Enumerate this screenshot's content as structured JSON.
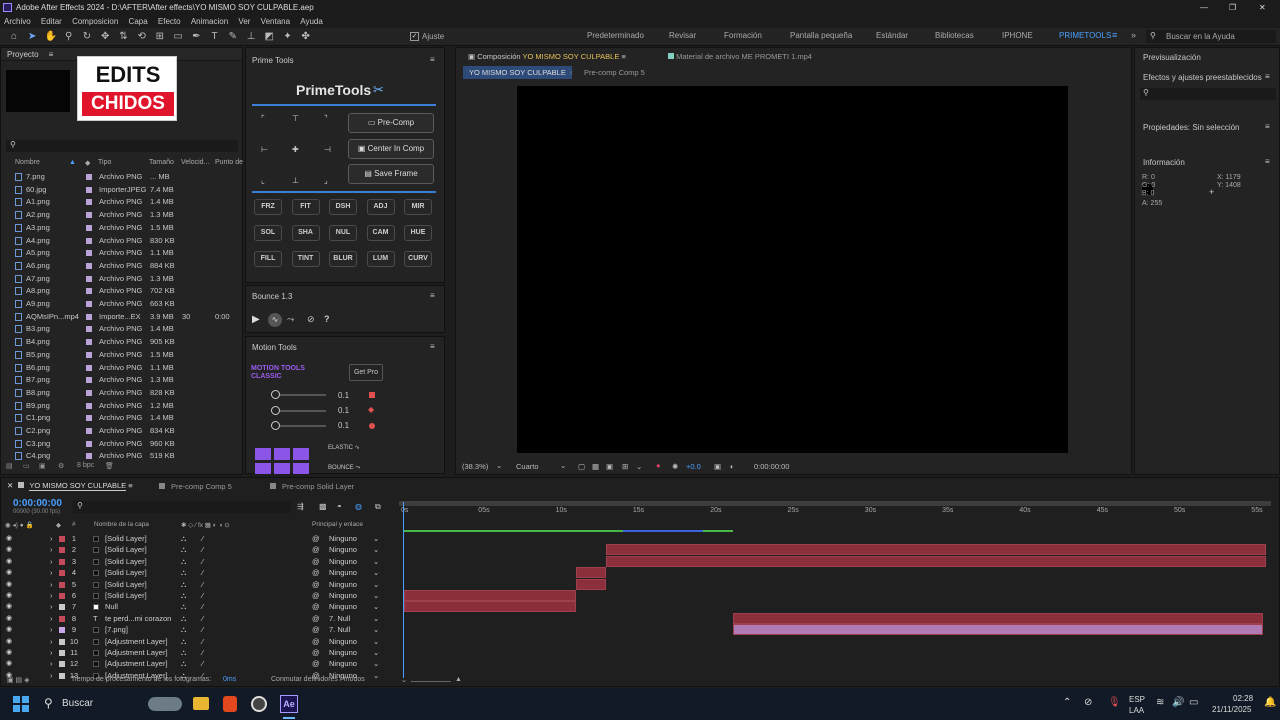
{
  "app": {
    "title": "Adobe After Effects 2024 - D:\\AFTER\\After effects\\YO MISMO SOY CULPABLE.aep"
  },
  "menu": [
    "Archivo",
    "Editar",
    "Composicion",
    "Capa",
    "Efecto",
    "Animacion",
    "Ver",
    "Ventana",
    "Ayuda"
  ],
  "toolbar": {
    "ajuste": "Ajuste"
  },
  "workspaces": [
    "Predeterminado",
    "Revisar",
    "Formación",
    "Pantalla pequeña",
    "Estándar",
    "Bibliotecas",
    "IPHONE",
    "PRIMETOOLS"
  ],
  "search_help": "Buscar en la Ayuda",
  "project": {
    "tab": "Proyecto",
    "thumb_line1": "EDITS",
    "thumb_line2": "CHIDOS",
    "columns": {
      "name": "Nombre",
      "type": "Tipo",
      "size": "Tamaño",
      "speed": "Velocid...",
      "point": "Punto de"
    },
    "bpc": "8 bpc",
    "files": [
      {
        "name": "7.png",
        "type": "Archivo PNG",
        "size": "... MB"
      },
      {
        "name": "60.jpg",
        "type": "ImporterJPEG",
        "size": "7.4 MB"
      },
      {
        "name": "A1.png",
        "type": "Archivo PNG",
        "size": "1.4 MB"
      },
      {
        "name": "A2.png",
        "type": "Archivo PNG",
        "size": "1.3 MB"
      },
      {
        "name": "A3.png",
        "type": "Archivo PNG",
        "size": "1.5 MB"
      },
      {
        "name": "A4.png",
        "type": "Archivo PNG",
        "size": "830 KB"
      },
      {
        "name": "A5.png",
        "type": "Archivo PNG",
        "size": "1.1 MB"
      },
      {
        "name": "A6.png",
        "type": "Archivo PNG",
        "size": "884 KB"
      },
      {
        "name": "A7.png",
        "type": "Archivo PNG",
        "size": "1.3 MB"
      },
      {
        "name": "A8.png",
        "type": "Archivo PNG",
        "size": "702 KB"
      },
      {
        "name": "A9.png",
        "type": "Archivo PNG",
        "size": "663 KB"
      },
      {
        "name": "AQMsIPn...mp4",
        "type": "Importe...EX",
        "size": "3.9 MB",
        "speed": "30",
        "point": "0:00"
      },
      {
        "name": "B3.png",
        "type": "Archivo PNG",
        "size": "1.4 MB"
      },
      {
        "name": "B4.png",
        "type": "Archivo PNG",
        "size": "905 KB"
      },
      {
        "name": "B5.png",
        "type": "Archivo PNG",
        "size": "1.5 MB"
      },
      {
        "name": "B6.png",
        "type": "Archivo PNG",
        "size": "1.1 MB"
      },
      {
        "name": "B7.png",
        "type": "Archivo PNG",
        "size": "1.3 MB"
      },
      {
        "name": "B8.png",
        "type": "Archivo PNG",
        "size": "828 KB"
      },
      {
        "name": "B9.png",
        "type": "Archivo PNG",
        "size": "1.2 MB"
      },
      {
        "name": "C1.png",
        "type": "Archivo PNG",
        "size": "1.4 MB"
      },
      {
        "name": "C2.png",
        "type": "Archivo PNG",
        "size": "834 KB"
      },
      {
        "name": "C3.png",
        "type": "Archivo PNG",
        "size": "960 KB"
      },
      {
        "name": "C4.png",
        "type": "Archivo PNG",
        "size": "519 KB"
      }
    ]
  },
  "primetools": {
    "panel": "Prime Tools",
    "title": "PrimeTools",
    "precomp": "Pre-Comp",
    "center": "Center In Comp",
    "save": "Save Frame",
    "buttons": [
      "FRZ",
      "FIT",
      "DSH",
      "ADJ",
      "MIR",
      "SOL",
      "SHA",
      "NUL",
      "CAM",
      "HUE",
      "FILL",
      "TINT",
      "BLUR",
      "LUM",
      "CURV"
    ]
  },
  "bounce": {
    "title": "Bounce 1.3"
  },
  "motion": {
    "title": "Motion Tools",
    "brand1": "MOTION TOOLS",
    "brand2": "CLASSIC",
    "getpro": "Get Pro",
    "values": [
      "0.1",
      "0.1",
      "0.1"
    ],
    "elastic": "ELASTIC",
    "bounce": "BOUNCE"
  },
  "comp": {
    "tab_prefix": "Composición",
    "tab_name": "YO MISMO SOY CULPABLE",
    "footage": "Material de archivo  ME PROMETI 1.mp4",
    "subtab1": "YO MISMO SOY CULPABLE",
    "subtab2": "Pre-comp Comp 5",
    "zoom": "(38.3%)",
    "quality": "Cuarto",
    "exposure": "+0.0",
    "time": "0:00:00:00"
  },
  "right": {
    "preview": "Previsualización",
    "effects": "Efectos y ajustes preestablecidos",
    "props": "Propiedades: Sin selección",
    "info": "Información",
    "r": "R:  0",
    "g": "G:  0",
    "b": "B:  0",
    "a": "A:  255",
    "x": "X:  1179",
    "y": "Y:  1408"
  },
  "timeline": {
    "tabs": [
      "YO MISMO SOY CULPABLE",
      "Pre-comp Comp 5",
      "Pre-comp Solid Layer"
    ],
    "time": "0:00:00:00",
    "fps": "00000 (30.00 fps)",
    "col_name": "Nombre de la capa",
    "col_parent": "Principal y enlace",
    "col_hash": "#",
    "ticks": [
      "0s",
      "05s",
      "10s",
      "15s",
      "20s",
      "25s",
      "30s",
      "35s",
      "40s",
      "45s",
      "50s",
      "55s"
    ],
    "layers": [
      {
        "n": "1",
        "name": "[Solid Layer]",
        "parent": "Ninguno"
      },
      {
        "n": "2",
        "name": "[Solid Layer]",
        "parent": "Ninguno"
      },
      {
        "n": "3",
        "name": "[Solid Layer]",
        "parent": "Ninguno"
      },
      {
        "n": "4",
        "name": "[Solid Layer]",
        "parent": "Ninguno"
      },
      {
        "n": "5",
        "name": "[Solid Layer]",
        "parent": "Ninguno"
      },
      {
        "n": "6",
        "name": "[Solid Layer]",
        "parent": "Ninguno"
      },
      {
        "n": "7",
        "name": "Null",
        "parent": "Ninguno"
      },
      {
        "n": "8",
        "name": "te perd...mi corazon",
        "parent": "7. Null"
      },
      {
        "n": "9",
        "name": "[7.png]",
        "parent": "7. Null"
      },
      {
        "n": "10",
        "name": "[Adjustment Layer]",
        "parent": "Ninguno"
      },
      {
        "n": "11",
        "name": "[Adjustment Layer]",
        "parent": "Ninguno"
      },
      {
        "n": "12",
        "name": "[Adjustment Layer]",
        "parent": "Ninguno"
      },
      {
        "n": "13",
        "name": "[Adjustment Layer]",
        "parent": "Ninguno"
      }
    ],
    "status_label": "Tiempo de procesamiento de los fotogramas:",
    "status_value": "0ms",
    "toggle": "Conmutar definidores / modos"
  },
  "taskbar": {
    "search": "Buscar",
    "lang1": "ESP",
    "lang2": "LAA",
    "time": "02:28",
    "date": "21/11/2025"
  }
}
